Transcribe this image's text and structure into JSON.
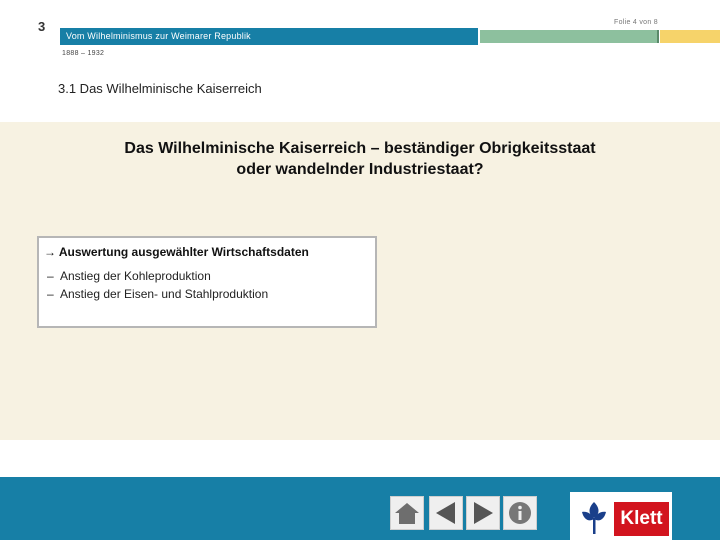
{
  "header": {
    "chapter_number": "3",
    "title": "Vom Wilhelminismus zur Weimarer Republik",
    "slide_counter": "Folie 4 von 8",
    "period": "1888 – 1932",
    "accent_blue": "#177fa6",
    "accent_green": "#8dc09e",
    "accent_yellow": "#f6d36a"
  },
  "section": {
    "title": "3.1  Das Wilhelminische Kaiserreich"
  },
  "main": {
    "question_line1": "Das Wilhelminische Kaiserreich – beständiger Obrigkeitsstaat",
    "question_line2": "oder wandelnder Industriestaat?",
    "topic": {
      "heading": "→ Auswertung ausgewählter Wirtschaftsdaten",
      "items": [
        "Anstieg der Kohleproduktion",
        "Anstieg der Eisen- und Stahlproduktion"
      ]
    }
  },
  "footer": {
    "nav_buttons": [
      {
        "icon": "home-icon"
      },
      {
        "icon": "arrow-left-icon"
      },
      {
        "icon": "arrow-right-icon"
      },
      {
        "icon": "info-icon"
      }
    ],
    "logo_text": "Klett",
    "logo_color": "#d2141e"
  }
}
